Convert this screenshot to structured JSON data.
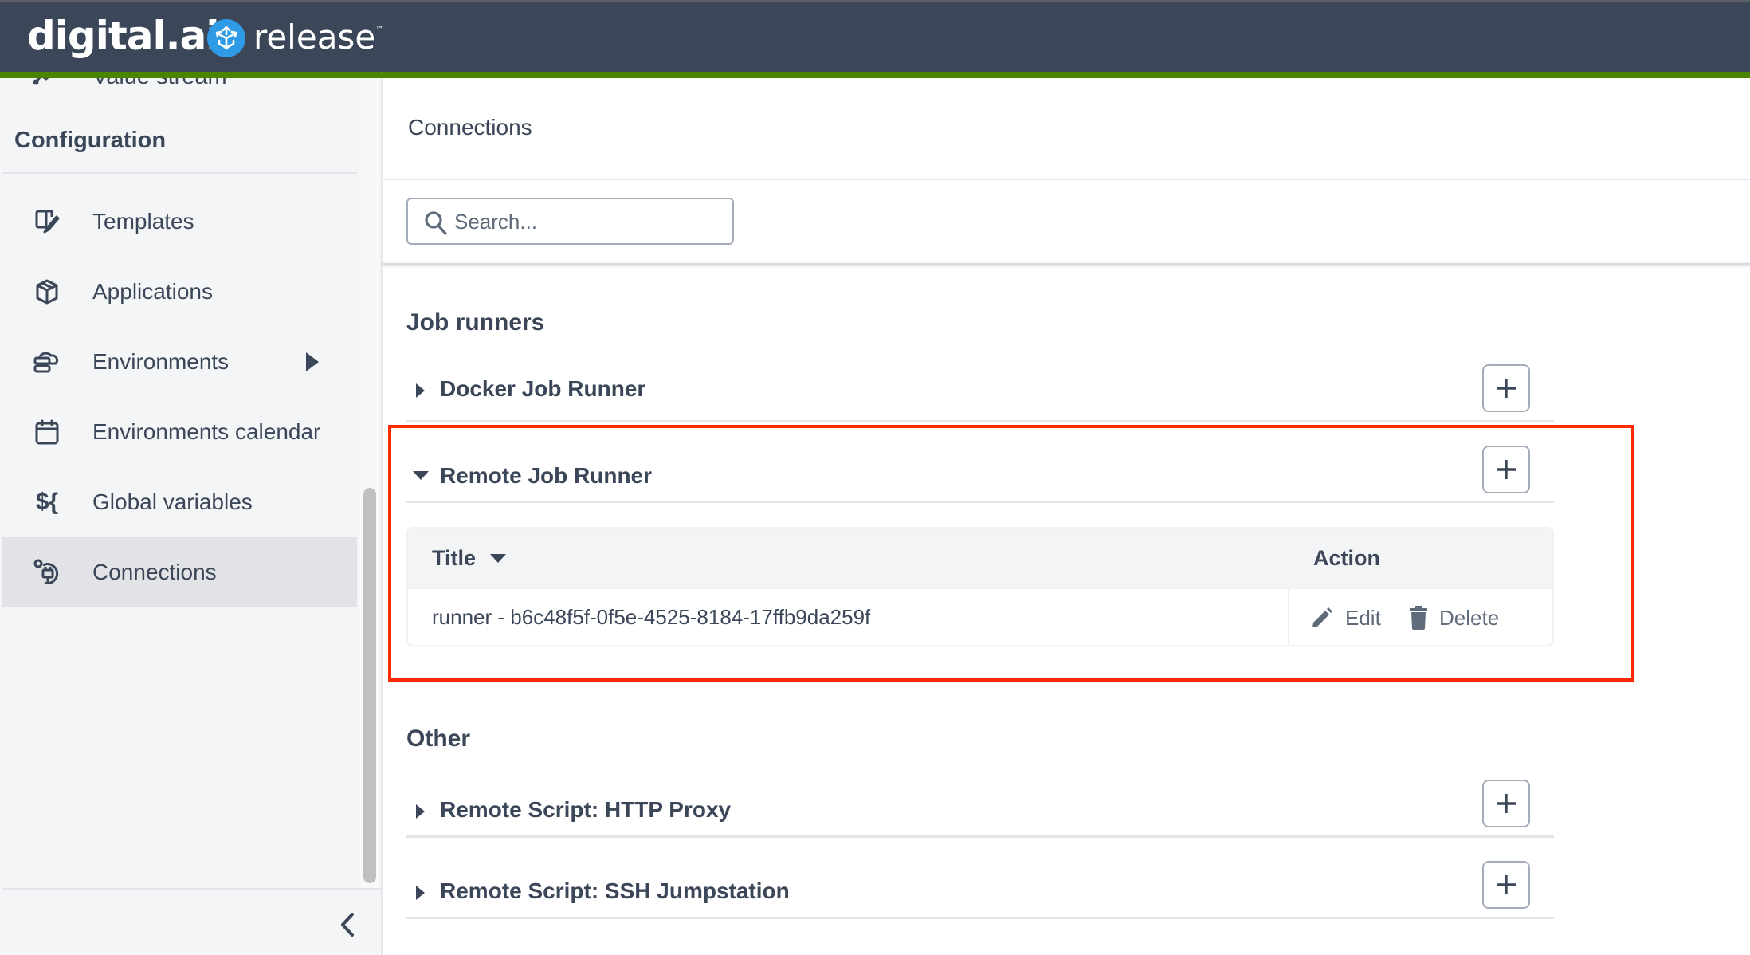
{
  "header": {
    "brand": "digital.ai",
    "brand_tm": "™",
    "product": "release",
    "product_tm": "™",
    "colors": {
      "bar": "#3b4759",
      "accent": "#4a8500",
      "product_badge": "#2f9ae5"
    }
  },
  "sidebar": {
    "partial_item": {
      "label": "Value stream",
      "icon": "chart-line-icon"
    },
    "section_title": "Configuration",
    "items": [
      {
        "label": "Templates",
        "icon": "template-icon",
        "active": false
      },
      {
        "label": "Applications",
        "icon": "cube-icon",
        "active": false
      },
      {
        "label": "Environments",
        "icon": "server-cloud-icon",
        "active": false,
        "has_submenu": true
      },
      {
        "label": "Environments calendar",
        "icon": "calendar-icon",
        "active": false
      },
      {
        "label": "Global variables",
        "icon": "variable-icon",
        "symbol": "${",
        "active": false
      },
      {
        "label": "Connections",
        "icon": "plug-icon",
        "active": true
      }
    ],
    "collapse_icon": "chevron-left-icon"
  },
  "main": {
    "title": "Connections",
    "search": {
      "placeholder": "Search...",
      "value": ""
    },
    "sections": [
      {
        "title": "Job runners",
        "groups": [
          {
            "label": "Docker Job Runner",
            "expanded": false,
            "add_label": "+"
          },
          {
            "label": "Remote Job Runner",
            "expanded": true,
            "add_label": "+"
          }
        ]
      },
      {
        "title": "Other",
        "groups": [
          {
            "label": "Remote Script: HTTP Proxy",
            "expanded": false,
            "add_label": "+"
          },
          {
            "label": "Remote Script: SSH Jumpstation",
            "expanded": false,
            "add_label": "+"
          }
        ]
      }
    ],
    "table": {
      "columns": {
        "title": "Title",
        "action": "Action"
      },
      "sort": "descending",
      "rows": [
        {
          "title": "runner - b6c48f5f-0f5e-4525-8184-17ffb9da259f",
          "edit_label": "Edit",
          "delete_label": "Delete"
        }
      ]
    },
    "highlight_color": "#ff2a00"
  }
}
